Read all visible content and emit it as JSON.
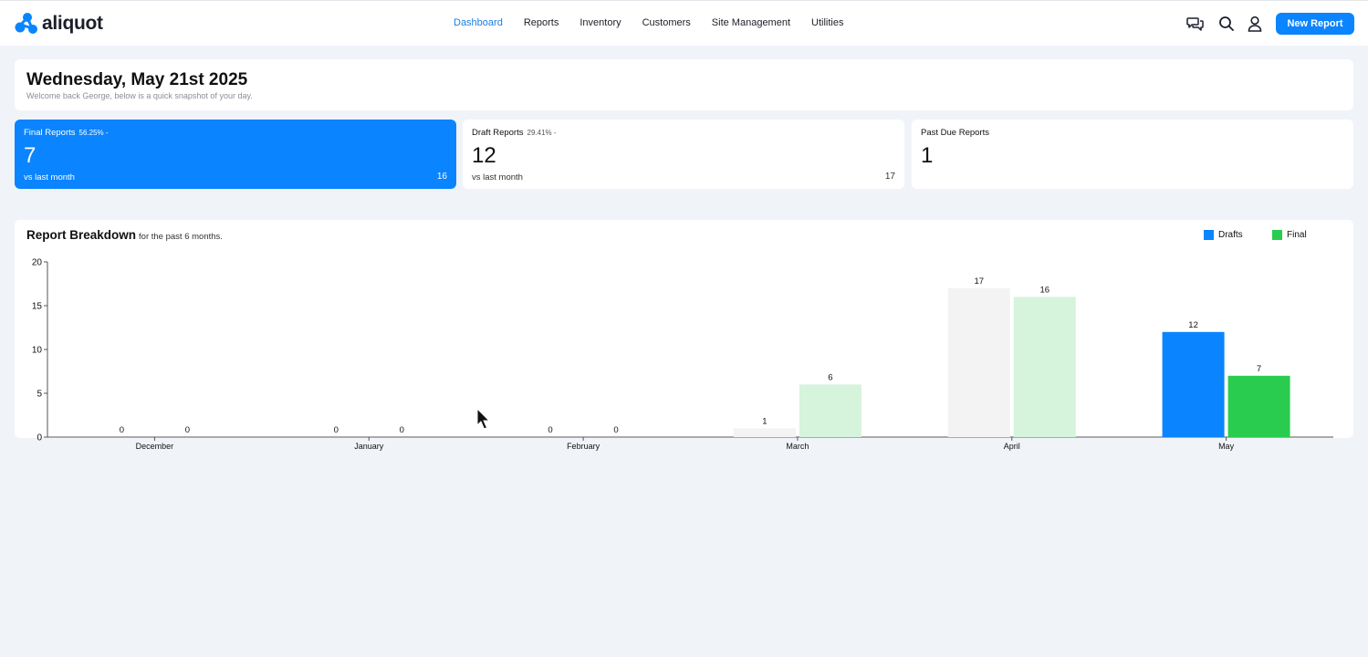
{
  "brand": {
    "name": "aliquot",
    "color": "#0a84ff"
  },
  "nav": {
    "items": [
      {
        "label": "Dashboard",
        "active": true
      },
      {
        "label": "Reports"
      },
      {
        "label": "Inventory"
      },
      {
        "label": "Customers"
      },
      {
        "label": "Site Management"
      },
      {
        "label": "Utilities"
      }
    ]
  },
  "toolbar": {
    "icons": [
      "chat-icon",
      "search-icon",
      "user-icon"
    ],
    "new_report_label": "New Report"
  },
  "welcome": {
    "date": "Wednesday, May 21st 2025",
    "message": "Welcome back George, below is a quick snapshot of your day."
  },
  "stats": [
    {
      "label": "Final Reports",
      "pct": "56.25% -",
      "value": "7",
      "sub": "vs last month",
      "prev": "16"
    },
    {
      "label": "Draft Reports",
      "pct": "29.41% -",
      "value": "12",
      "sub": "vs last month",
      "prev": "17"
    },
    {
      "label": "Past Due Reports",
      "value": "1"
    }
  ],
  "chart_data": {
    "type": "bar",
    "title": "Report Breakdown",
    "subtitle": "for the past 6 months.",
    "categories": [
      "December",
      "January",
      "February",
      "March",
      "April",
      "May"
    ],
    "series": [
      {
        "name": "Drafts",
        "values": [
          0,
          0,
          0,
          1,
          17,
          12
        ],
        "color": "#0a84ff",
        "faded_color": "#f3f3f3"
      },
      {
        "name": "Final",
        "values": [
          0,
          0,
          0,
          6,
          16,
          7
        ],
        "color": "#29cc4f",
        "faded_color": "#d6f3dc"
      }
    ],
    "highlighted_category": "May",
    "ylim": [
      0,
      20
    ],
    "yticks": [
      0,
      5,
      10,
      15,
      20
    ],
    "legend_position": "top-right",
    "grid": false
  }
}
